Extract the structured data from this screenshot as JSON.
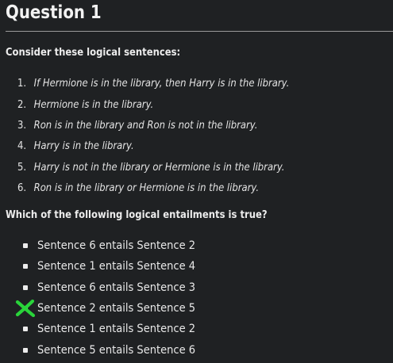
{
  "question": {
    "title": "Question 1",
    "prompt": "Consider these logical sentences:",
    "sentences": [
      {
        "number": "1.",
        "text": "If Hermione is in the library, then Harry is in the library."
      },
      {
        "number": "2.",
        "text": "Hermione is in the library."
      },
      {
        "number": "3.",
        "text": "Ron is in the library and Ron is not in the library."
      },
      {
        "number": "4.",
        "text": "Harry is in the library."
      },
      {
        "number": "5.",
        "text": "Harry is not in the library or Hermione is in the library."
      },
      {
        "number": "6.",
        "text": "Ron is in the library or Hermione is in the library."
      }
    ],
    "options_prompt": "Which of the following logical entailments is true?",
    "options": [
      {
        "label": "Sentence 6 entails Sentence 2",
        "marked": false
      },
      {
        "label": "Sentence 1 entails Sentence 4",
        "marked": false
      },
      {
        "label": "Sentence 6 entails Sentence 3",
        "marked": false
      },
      {
        "label": "Sentence 2 entails Sentence 5",
        "marked": true
      },
      {
        "label": "Sentence 1 entails Sentence 2",
        "marked": false
      },
      {
        "label": "Sentence 5 entails Sentence 6",
        "marked": false
      }
    ],
    "mark_icon": "green-x-mark-icon",
    "mark_color": "#29d43a",
    "background_color": "#1f2123",
    "text_color": "#e4e4e4"
  }
}
